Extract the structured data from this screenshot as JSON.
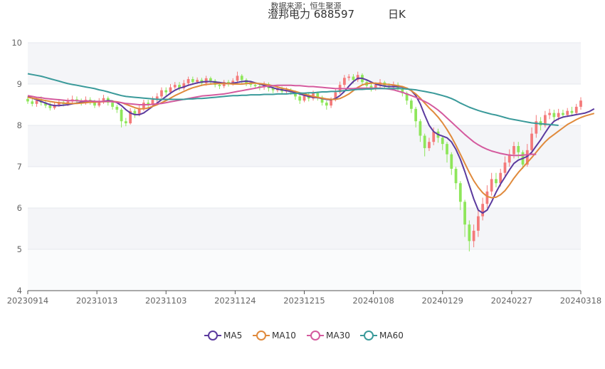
{
  "chart_data": {
    "type": "candlestick",
    "title": "澄邦电力 688597",
    "period_label": "日K",
    "source_text": "数据来源：恒生聚源",
    "ylim": [
      4,
      10
    ],
    "yticks": [
      "4",
      "5",
      "6",
      "7",
      "8",
      "9",
      "10"
    ],
    "xticks": [
      "20230914",
      "20231013",
      "20231103",
      "20231124",
      "20231215",
      "20240108",
      "20240129",
      "20240227",
      "20240318"
    ],
    "colors": {
      "up": "#f47a7a",
      "down": "#8ee65a",
      "band": "#f4f5f8"
    },
    "candles": [
      [
        8.64,
        8.58,
        8.7,
        8.52
      ],
      [
        8.58,
        8.52,
        8.66,
        8.46
      ],
      [
        8.52,
        8.6,
        8.68,
        8.45
      ],
      [
        8.6,
        8.55,
        8.7,
        8.48
      ],
      [
        8.55,
        8.48,
        8.62,
        8.42
      ],
      [
        8.48,
        8.42,
        8.55,
        8.36
      ],
      [
        8.42,
        8.5,
        8.58,
        8.38
      ],
      [
        8.5,
        8.56,
        8.64,
        8.45
      ],
      [
        8.56,
        8.52,
        8.62,
        8.46
      ],
      [
        8.52,
        8.58,
        8.66,
        8.47
      ],
      [
        8.58,
        8.63,
        8.72,
        8.52
      ],
      [
        8.63,
        8.58,
        8.7,
        8.52
      ],
      [
        8.58,
        8.55,
        8.65,
        8.48
      ],
      [
        8.55,
        8.62,
        8.7,
        8.5
      ],
      [
        8.62,
        8.56,
        8.68,
        8.5
      ],
      [
        8.56,
        8.48,
        8.62,
        8.42
      ],
      [
        8.48,
        8.58,
        8.66,
        8.44
      ],
      [
        8.58,
        8.66,
        8.74,
        8.52
      ],
      [
        8.66,
        8.55,
        8.7,
        8.48
      ],
      [
        8.55,
        8.45,
        8.6,
        8.38
      ],
      [
        8.45,
        8.38,
        8.5,
        8.3
      ],
      [
        8.38,
        8.1,
        8.42,
        7.95
      ],
      [
        8.1,
        8.05,
        8.18,
        7.98
      ],
      [
        8.05,
        8.35,
        8.42,
        8.02
      ],
      [
        8.35,
        8.28,
        8.4,
        8.18
      ],
      [
        8.28,
        8.4,
        8.48,
        8.22
      ],
      [
        8.4,
        8.55,
        8.62,
        8.35
      ],
      [
        8.55,
        8.5,
        8.62,
        8.44
      ],
      [
        8.5,
        8.62,
        8.7,
        8.46
      ],
      [
        8.62,
        8.7,
        8.78,
        8.56
      ],
      [
        8.7,
        8.85,
        8.92,
        8.65
      ],
      [
        8.85,
        8.8,
        8.92,
        8.72
      ],
      [
        8.8,
        8.92,
        9.0,
        8.75
      ],
      [
        8.92,
        8.98,
        9.05,
        8.88
      ],
      [
        8.98,
        8.9,
        9.05,
        8.84
      ],
      [
        8.9,
        9.02,
        9.1,
        8.85
      ],
      [
        9.02,
        9.12,
        9.18,
        8.95
      ],
      [
        9.12,
        9.05,
        9.18,
        8.98
      ],
      [
        9.05,
        9.1,
        9.16,
        9.0
      ],
      [
        9.1,
        9.02,
        9.15,
        8.95
      ],
      [
        9.02,
        9.14,
        9.2,
        8.96
      ],
      [
        9.14,
        9.08,
        9.18,
        9.0
      ],
      [
        9.08,
        8.98,
        9.12,
        8.92
      ],
      [
        8.98,
        8.95,
        9.05,
        8.88
      ],
      [
        8.95,
        9.05,
        9.1,
        8.9
      ],
      [
        9.05,
        9.0,
        9.1,
        8.94
      ],
      [
        9.0,
        9.08,
        9.14,
        8.96
      ],
      [
        9.08,
        9.2,
        9.3,
        9.02
      ],
      [
        9.2,
        9.1,
        9.24,
        9.02
      ],
      [
        9.1,
        9.02,
        9.14,
        8.95
      ],
      [
        9.02,
        8.98,
        9.08,
        8.92
      ],
      [
        8.98,
        8.95,
        9.02,
        8.88
      ],
      [
        8.95,
        8.92,
        9.0,
        8.85
      ],
      [
        8.92,
        9.0,
        9.06,
        8.86
      ],
      [
        9.0,
        8.9,
        9.04,
        8.82
      ],
      [
        8.9,
        8.85,
        8.96,
        8.78
      ],
      [
        8.85,
        8.9,
        8.95,
        8.8
      ],
      [
        8.9,
        8.82,
        8.94,
        8.76
      ],
      [
        8.82,
        8.86,
        8.92,
        8.78
      ],
      [
        8.86,
        8.8,
        8.9,
        8.74
      ],
      [
        8.8,
        8.7,
        8.84,
        8.62
      ],
      [
        8.7,
        8.6,
        8.75,
        8.52
      ],
      [
        8.6,
        8.72,
        8.78,
        8.56
      ],
      [
        8.72,
        8.65,
        8.78,
        8.58
      ],
      [
        8.65,
        8.78,
        8.84,
        8.6
      ],
      [
        8.78,
        8.68,
        8.82,
        8.6
      ],
      [
        8.68,
        8.55,
        8.72,
        8.48
      ],
      [
        8.55,
        8.48,
        8.6,
        8.38
      ],
      [
        8.48,
        8.62,
        8.68,
        8.42
      ],
      [
        8.62,
        8.8,
        8.88,
        8.58
      ],
      [
        8.8,
        8.98,
        9.06,
        8.76
      ],
      [
        8.98,
        9.15,
        9.22,
        8.92
      ],
      [
        9.15,
        9.18,
        9.24,
        9.08
      ],
      [
        9.18,
        9.1,
        9.24,
        9.02
      ],
      [
        9.1,
        9.22,
        9.3,
        9.05
      ],
      [
        9.22,
        9.05,
        9.26,
        8.98
      ],
      [
        9.05,
        8.96,
        9.1,
        8.88
      ],
      [
        8.96,
        8.9,
        9.02,
        8.82
      ],
      [
        8.9,
        8.98,
        9.04,
        8.84
      ],
      [
        8.98,
        9.04,
        9.12,
        8.92
      ],
      [
        9.04,
        8.96,
        9.08,
        8.88
      ],
      [
        8.96,
        8.92,
        9.02,
        8.86
      ],
      [
        8.92,
        8.98,
        9.06,
        8.86
      ],
      [
        8.98,
        8.9,
        9.04,
        8.84
      ],
      [
        8.9,
        8.78,
        8.95,
        8.7
      ],
      [
        8.78,
        8.6,
        8.82,
        8.5
      ],
      [
        8.6,
        8.4,
        8.65,
        8.3
      ],
      [
        8.4,
        8.1,
        8.45,
        7.95
      ],
      [
        8.1,
        7.75,
        8.15,
        7.6
      ],
      [
        7.75,
        7.45,
        7.8,
        7.25
      ],
      [
        7.45,
        7.6,
        7.7,
        7.38
      ],
      [
        7.6,
        7.85,
        7.95,
        7.52
      ],
      [
        7.85,
        7.7,
        7.92,
        7.58
      ],
      [
        7.7,
        7.55,
        7.75,
        7.4
      ],
      [
        7.55,
        7.3,
        7.6,
        7.1
      ],
      [
        7.3,
        6.95,
        7.35,
        6.8
      ],
      [
        6.95,
        6.6,
        7.0,
        6.45
      ],
      [
        6.6,
        6.15,
        6.65,
        5.95
      ],
      [
        6.15,
        5.6,
        6.2,
        5.3
      ],
      [
        5.6,
        5.2,
        5.7,
        4.95
      ],
      [
        5.2,
        5.45,
        5.6,
        5.05
      ],
      [
        5.45,
        5.8,
        5.95,
        5.3
      ],
      [
        5.8,
        6.1,
        6.25,
        5.7
      ],
      [
        6.1,
        6.4,
        6.55,
        6.0
      ],
      [
        6.4,
        6.7,
        6.85,
        6.3
      ],
      [
        6.7,
        6.6,
        6.85,
        6.5
      ],
      [
        6.6,
        6.85,
        6.95,
        6.52
      ],
      [
        6.85,
        7.1,
        7.25,
        6.75
      ],
      [
        7.1,
        7.3,
        7.42,
        7.0
      ],
      [
        7.3,
        7.5,
        7.6,
        7.2
      ],
      [
        7.5,
        7.35,
        7.6,
        7.2
      ],
      [
        7.35,
        7.05,
        7.4,
        6.95
      ],
      [
        7.05,
        7.4,
        7.55,
        7.0
      ],
      [
        7.4,
        7.8,
        7.95,
        7.3
      ],
      [
        7.8,
        8.1,
        8.25,
        7.7
      ],
      [
        8.1,
        8.0,
        8.2,
        7.88
      ],
      [
        8.0,
        8.25,
        8.35,
        7.95
      ],
      [
        8.25,
        8.3,
        8.4,
        8.15
      ],
      [
        8.3,
        8.2,
        8.38,
        8.1
      ],
      [
        8.2,
        8.3,
        8.4,
        8.12
      ],
      [
        8.3,
        8.25,
        8.38,
        8.18
      ],
      [
        8.25,
        8.35,
        8.42,
        8.2
      ],
      [
        8.35,
        8.3,
        8.45,
        8.22
      ],
      [
        8.3,
        8.45,
        8.52,
        8.25
      ],
      [
        8.45,
        8.6,
        8.68,
        8.38
      ]
    ],
    "series": [
      {
        "name": "MA5",
        "color": "#5b3a9e",
        "values": [
          8.7,
          8.66,
          8.62,
          8.58,
          8.54,
          8.5,
          8.48,
          8.48,
          8.49,
          8.5,
          8.52,
          8.54,
          8.56,
          8.58,
          8.59,
          8.58,
          8.57,
          8.58,
          8.6,
          8.59,
          8.55,
          8.48,
          8.38,
          8.3,
          8.26,
          8.26,
          8.3,
          8.38,
          8.46,
          8.54,
          8.62,
          8.7,
          8.78,
          8.85,
          8.9,
          8.93,
          8.97,
          9.0,
          9.03,
          9.05,
          9.06,
          9.06,
          9.05,
          9.04,
          9.02,
          9.01,
          9.02,
          9.04,
          9.06,
          9.07,
          9.06,
          9.03,
          9.0,
          8.97,
          8.94,
          8.91,
          8.88,
          8.86,
          8.84,
          8.82,
          8.79,
          8.76,
          8.73,
          8.7,
          8.68,
          8.67,
          8.65,
          8.63,
          8.62,
          8.65,
          8.72,
          8.82,
          8.95,
          9.06,
          9.14,
          9.14,
          9.1,
          9.05,
          9.0,
          8.97,
          8.95,
          8.94,
          8.94,
          8.94,
          8.93,
          8.9,
          8.84,
          8.72,
          8.52,
          8.25,
          8.0,
          7.85,
          7.78,
          7.74,
          7.7,
          7.6,
          7.42,
          7.18,
          6.88,
          6.55,
          6.22,
          5.95,
          5.88,
          5.95,
          6.15,
          6.38,
          6.58,
          6.75,
          6.92,
          7.08,
          7.16,
          7.2,
          7.25,
          7.35,
          7.5,
          7.65,
          7.82,
          7.98,
          8.1,
          8.16,
          8.2,
          8.22,
          8.24,
          8.26,
          8.28,
          8.3,
          8.34,
          8.4
        ]
      },
      {
        "name": "MA10",
        "color": "#e08a3c",
        "values": [
          8.68,
          8.66,
          8.64,
          8.62,
          8.6,
          8.58,
          8.56,
          8.55,
          8.54,
          8.53,
          8.53,
          8.53,
          8.54,
          8.55,
          8.56,
          8.56,
          8.57,
          8.57,
          8.58,
          8.58,
          8.57,
          8.55,
          8.51,
          8.47,
          8.43,
          8.4,
          8.4,
          8.42,
          8.46,
          8.5,
          8.55,
          8.6,
          8.66,
          8.72,
          8.77,
          8.82,
          8.87,
          8.91,
          8.94,
          8.97,
          8.99,
          9.0,
          9.01,
          9.01,
          9.01,
          9.01,
          9.0,
          9.0,
          9.0,
          9.01,
          9.02,
          9.02,
          9.01,
          9.0,
          8.98,
          8.96,
          8.93,
          8.9,
          8.88,
          8.85,
          8.82,
          8.79,
          8.76,
          8.73,
          8.7,
          8.68,
          8.66,
          8.64,
          8.63,
          8.63,
          8.65,
          8.7,
          8.76,
          8.84,
          8.92,
          8.98,
          9.01,
          9.02,
          9.02,
          9.01,
          9.0,
          8.99,
          8.98,
          8.96,
          8.94,
          8.9,
          8.84,
          8.76,
          8.66,
          8.54,
          8.42,
          8.32,
          8.2,
          8.06,
          7.9,
          7.72,
          7.52,
          7.3,
          7.08,
          6.86,
          6.66,
          6.5,
          6.37,
          6.28,
          6.25,
          6.26,
          6.32,
          6.42,
          6.56,
          6.72,
          6.86,
          6.98,
          7.1,
          7.22,
          7.35,
          7.48,
          7.6,
          7.7,
          7.78,
          7.86,
          7.94,
          8.02,
          8.08,
          8.14,
          8.19,
          8.23,
          8.26,
          8.29
        ]
      },
      {
        "name": "MA30",
        "color": "#d45a9e",
        "values": [
          8.72,
          8.7,
          8.68,
          8.67,
          8.65,
          8.64,
          8.63,
          8.62,
          8.61,
          8.6,
          8.6,
          8.6,
          8.59,
          8.59,
          8.59,
          8.58,
          8.58,
          8.58,
          8.58,
          8.57,
          8.56,
          8.55,
          8.53,
          8.52,
          8.51,
          8.5,
          8.5,
          8.5,
          8.51,
          8.52,
          8.53,
          8.55,
          8.57,
          8.59,
          8.61,
          8.63,
          8.65,
          8.67,
          8.69,
          8.71,
          8.72,
          8.73,
          8.74,
          8.75,
          8.76,
          8.78,
          8.8,
          8.82,
          8.84,
          8.86,
          8.88,
          8.9,
          8.92,
          8.94,
          8.95,
          8.96,
          8.97,
          8.97,
          8.97,
          8.97,
          8.96,
          8.96,
          8.95,
          8.94,
          8.94,
          8.93,
          8.92,
          8.91,
          8.9,
          8.89,
          8.89,
          8.89,
          8.89,
          8.89,
          8.9,
          8.9,
          8.9,
          8.9,
          8.9,
          8.9,
          8.89,
          8.88,
          8.86,
          8.83,
          8.8,
          8.76,
          8.72,
          8.68,
          8.63,
          8.58,
          8.52,
          8.45,
          8.37,
          8.28,
          8.18,
          8.08,
          7.98,
          7.88,
          7.78,
          7.69,
          7.6,
          7.53,
          7.47,
          7.42,
          7.38,
          7.35,
          7.32,
          7.3,
          7.28,
          7.27,
          7.27,
          7.28,
          7.29,
          7.3,
          7.3
        ]
      },
      {
        "name": "MA60",
        "color": "#3a9a9a",
        "values": [
          9.25,
          9.23,
          9.21,
          9.19,
          9.16,
          9.13,
          9.1,
          9.07,
          9.04,
          9.01,
          8.99,
          8.97,
          8.95,
          8.93,
          8.91,
          8.89,
          8.86,
          8.84,
          8.81,
          8.78,
          8.75,
          8.72,
          8.7,
          8.69,
          8.68,
          8.67,
          8.66,
          8.65,
          8.64,
          8.63,
          8.63,
          8.63,
          8.63,
          8.63,
          8.63,
          8.63,
          8.64,
          8.64,
          8.65,
          8.65,
          8.66,
          8.67,
          8.68,
          8.69,
          8.7,
          8.71,
          8.72,
          8.72,
          8.73,
          8.73,
          8.74,
          8.74,
          8.74,
          8.75,
          8.75,
          8.75,
          8.76,
          8.76,
          8.76,
          8.77,
          8.77,
          8.78,
          8.78,
          8.79,
          8.79,
          8.8,
          8.81,
          8.81,
          8.82,
          8.82,
          8.83,
          8.84,
          8.85,
          8.86,
          8.87,
          8.87,
          8.88,
          8.88,
          8.89,
          8.89,
          8.89,
          8.89,
          8.89,
          8.89,
          8.89,
          8.88,
          8.87,
          8.86,
          8.84,
          8.82,
          8.8,
          8.78,
          8.75,
          8.72,
          8.69,
          8.65,
          8.6,
          8.54,
          8.49,
          8.44,
          8.4,
          8.36,
          8.33,
          8.3,
          8.27,
          8.25,
          8.22,
          8.19,
          8.16,
          8.14,
          8.12,
          8.1,
          8.08,
          8.06,
          8.05,
          8.04,
          8.03,
          8.02,
          8.01,
          8.0
        ]
      }
    ],
    "legend": [
      {
        "label": "MA5",
        "color": "#5b3a9e"
      },
      {
        "label": "MA10",
        "color": "#e08a3c"
      },
      {
        "label": "MA30",
        "color": "#d45a9e"
      },
      {
        "label": "MA60",
        "color": "#3a9a9a"
      }
    ]
  }
}
